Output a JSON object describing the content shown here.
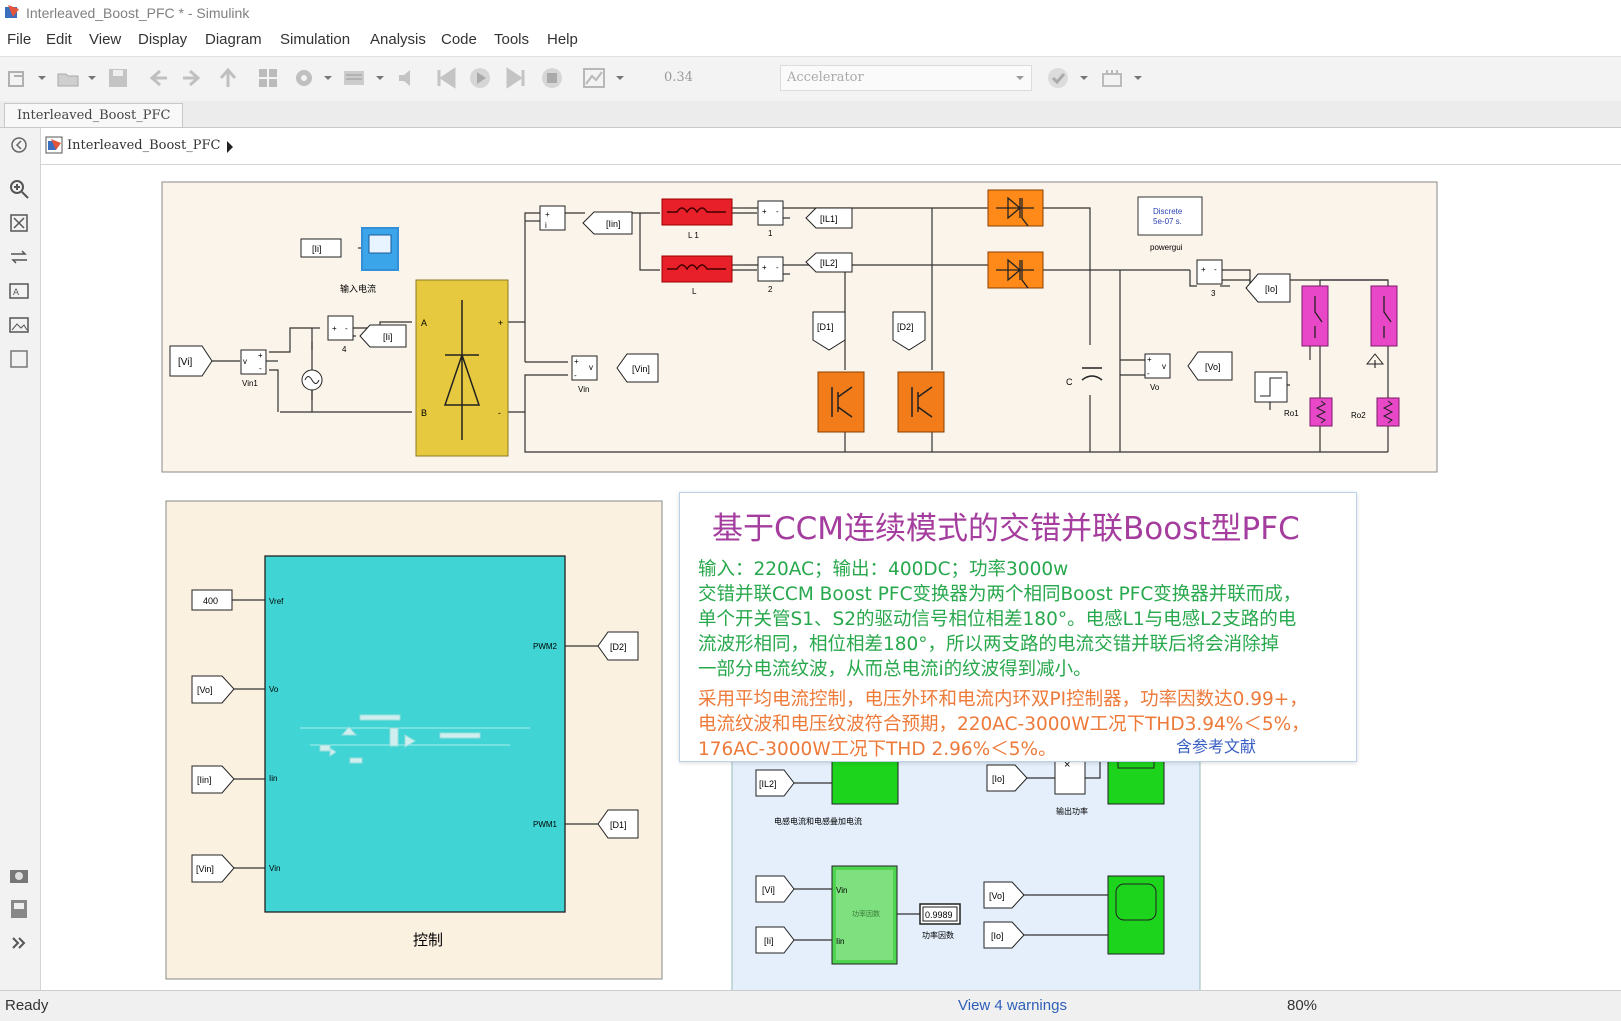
{
  "window": {
    "title": "Interleaved_Boost_PFC * - Simulink"
  },
  "menu": [
    "File",
    "Edit",
    "View",
    "Display",
    "Diagram",
    "Simulation",
    "Analysis",
    "Code",
    "Tools",
    "Help"
  ],
  "toolbar": {
    "stop_time": "0.34",
    "sim_mode": "Accelerator"
  },
  "tab": {
    "label": "Interleaved_Boost_PFC"
  },
  "breadcrumb": {
    "model": "Interleaved_Boost_PFC"
  },
  "diagram": {
    "tags": {
      "ii": "[Ii]",
      "iin": "[Iin]",
      "il1": "[IL1]",
      "il2": "[IL2]",
      "vi": "[Vi]",
      "vin": "[Vin]",
      "vo": "[Vo]",
      "io": "[Io]",
      "d1": "[D1]",
      "d2": "[D2]"
    },
    "labels": {
      "scope_in": "输入电流",
      "vin1": "Vin1",
      "vin": "Vin",
      "vo": "Vo",
      "l1": "L 1",
      "l": "L",
      "n1": "1",
      "n2": "2",
      "n3": "3",
      "n4": "4",
      "c": "C",
      "ro1": "Ro1",
      "ro2": "Ro2",
      "bridge_a": "A",
      "bridge_b": "B",
      "powergui_name": "powergui",
      "powergui_l1": "Discrete",
      "powergui_l2": "5e-07 s."
    },
    "control": {
      "const": "400",
      "port_vref": "Vref",
      "port_vo": "Vo",
      "port_iin": "Iin",
      "port_vin": "Vin",
      "port_pwm2": "PWM2",
      "port_pwm1": "PWM1",
      "title": "控制"
    },
    "meas": {
      "label_il": "电感电流和电感叠加电流",
      "label_power": "输出功率",
      "pf_value": "0.9989",
      "pf_label": "功率因数",
      "pf_port_vin": "Vin",
      "pf_port_ii": "Iin",
      "pf_inner": "功率因数"
    }
  },
  "overlay": {
    "title": "基于CCM连续模式的交错并联Boost型PFC",
    "lines_green": [
      "输入：220AC；输出：400DC；功率3000w",
      "交错并联CCM Boost PFC变换器为两个相同Boost PFC变换器并联而成，",
      "单个开关管S1、S2的驱动信号相位相差180°。电感L1与电感L2支路的电",
      "流波形相同，相位相差180°，所以两支路的电流交错并联后将会消除掉",
      "一部分电流纹波，从而总电流i的纹波得到减小。"
    ],
    "lines_orange": [
      "采用平均电流控制，电压外环和电流内环双PI控制器，功率因数达0.99+，",
      "电流纹波和电压纹波符合预期，220AC-3000W工况下THD3.94%＜5%，",
      "176AC-3000W工况下THD 2.96%＜5%。"
    ],
    "ref": "含参考文献"
  },
  "status": {
    "ready": "Ready",
    "warnings": "View 4 warnings",
    "zoom": "80%"
  },
  "colors": {
    "inductor": "#e8202a",
    "diode": "#ff8a1a",
    "igbt": "#f27c1a",
    "switch": "#e848c8",
    "bridge": "#e6c93f",
    "control": "#41d4d4",
    "scope_green": "#1dd41d",
    "area1": "#fbf4ea",
    "area2": "#fbf1e1",
    "area3": "#e4effb",
    "overlay_title": "#a43d9e",
    "overlay_green": "#28a84c",
    "overlay_orange": "#ee7a3a"
  }
}
